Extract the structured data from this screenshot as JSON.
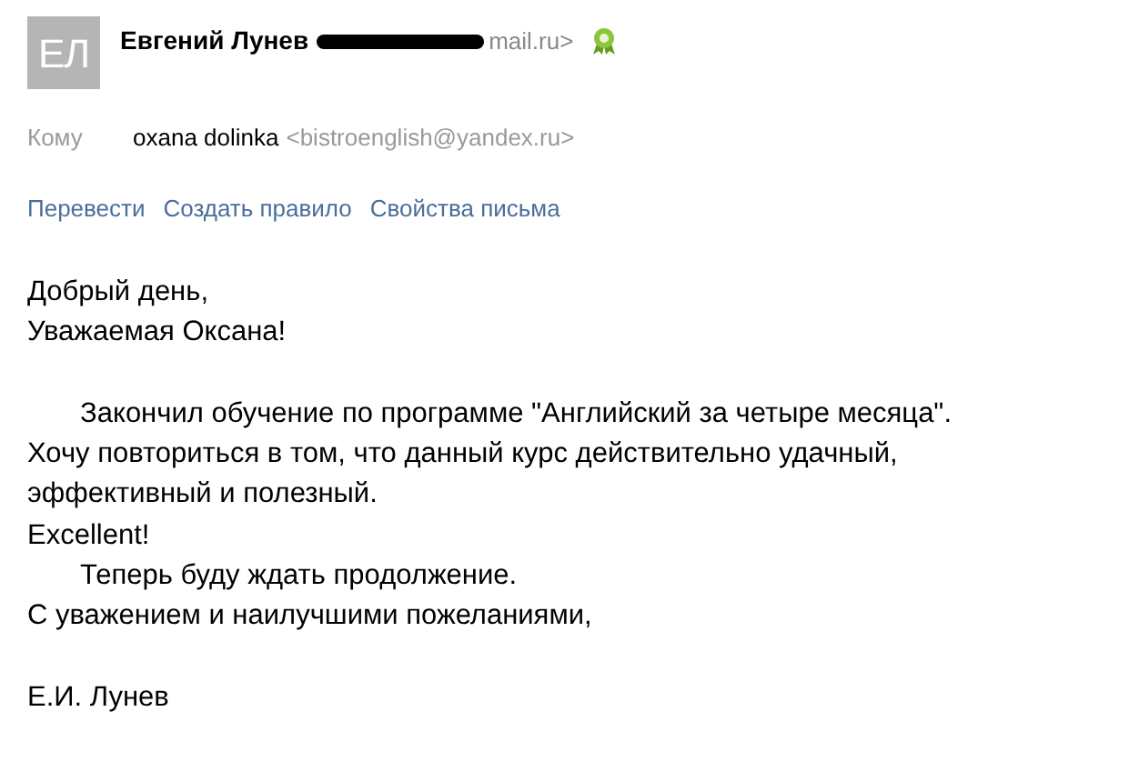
{
  "sender": {
    "avatar_initials": "ЕЛ",
    "name": "Евгений Лунев",
    "email_tail": "mail.ru>"
  },
  "recipient": {
    "label": "Кому",
    "name": "oxana dolinka",
    "email": "<bistroenglish@yandex.ru>"
  },
  "actions": [
    "Перевести",
    "Создать правило",
    "Свойства письма"
  ],
  "paragraphs": [
    {
      "lines": [
        {
          "kind": "plain",
          "text": "Добрый день,"
        },
        {
          "kind": "plain",
          "text": "Уважаемая Оксана!"
        }
      ]
    },
    {
      "lines": [
        {
          "kind": "indented",
          "text": "Закончил обучение по программе \"Английский за четыре месяца\"."
        },
        {
          "kind": "plain",
          "text": "Хочу повториться в том, что данный курс действительно удачный,"
        },
        {
          "kind": "plain",
          "text": "эффективный и полезный."
        },
        {
          "kind": "plain",
          "text": "Excellent!"
        },
        {
          "kind": "indented",
          "text": "Теперь буду ждать продолжение."
        },
        {
          "kind": "plain",
          "text": "С уважением и наилучшими пожеланиями,"
        }
      ]
    },
    {
      "lines": [
        {
          "kind": "plain",
          "text": "Е.И. Лунев"
        }
      ]
    }
  ]
}
